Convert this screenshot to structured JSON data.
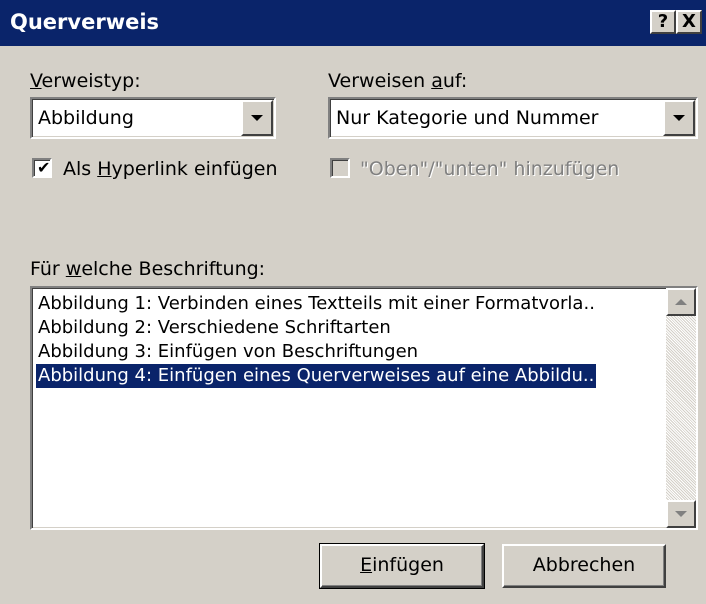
{
  "window": {
    "title": "Querverweis",
    "help_button": "?",
    "close_button": "X"
  },
  "verweistyp": {
    "label_pre": "",
    "label_accel": "V",
    "label_post": "erweistyp:",
    "selected": "Abbildung"
  },
  "verweisen_auf": {
    "label_pre": "Verweisen ",
    "label_accel": "a",
    "label_post": "uf:",
    "selected": "Nur Kategorie und Nummer"
  },
  "hyperlink_checkbox": {
    "checked": true,
    "label_pre": "Als ",
    "label_accel": "H",
    "label_post": "yperlink einfügen"
  },
  "oben_unten_checkbox": {
    "checked": false,
    "enabled": false,
    "label": "\"Oben\"/\"unten\" hinzufügen"
  },
  "beschriftung": {
    "label_pre": "Für ",
    "label_accel": "w",
    "label_post": "elche Beschriftung:",
    "items": [
      "Abbildung 1: Verbinden eines Textteils mit einer Formatvorla..",
      "Abbildung 2: Verschiedene Schriftarten",
      "Abbildung 3: Einfügen von Beschriftungen",
      "Abbildung 4: Einfügen eines Querverweises auf eine Abbildu.."
    ],
    "selected_index": 3
  },
  "buttons": {
    "insert_accel": "E",
    "insert_post": "infügen",
    "cancel": "Abbrechen"
  },
  "colors": {
    "titlebar": "#0a246a",
    "face": "#d4d0c8",
    "selection": "#0a246a"
  }
}
